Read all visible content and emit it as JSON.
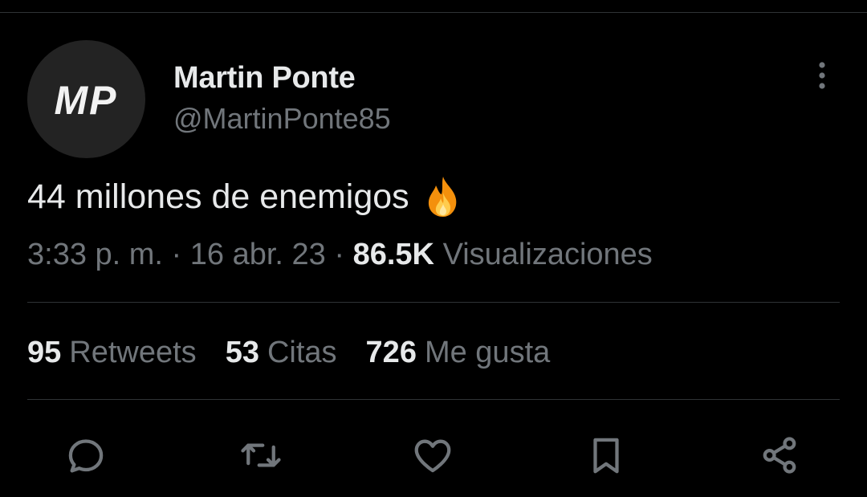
{
  "author": {
    "display_name": "Martin Ponte",
    "handle": "@MartinPonte85",
    "avatar_text": "MP"
  },
  "tweet": {
    "text": "44 millones de enemigos",
    "emoji": "fire-icon"
  },
  "meta": {
    "time": "3:33 p. m.",
    "separator": "·",
    "date": "16 abr. 23",
    "views_count": "86.5K",
    "views_label": "Visualizaciones"
  },
  "stats": {
    "retweets_count": "95",
    "retweets_label": "Retweets",
    "quotes_count": "53",
    "quotes_label": "Citas",
    "likes_count": "726",
    "likes_label": "Me gusta"
  },
  "actions": [
    "reply-icon",
    "retweet-icon",
    "like-icon",
    "bookmark-icon",
    "share-icon"
  ],
  "colors": {
    "background": "#000000",
    "primary_text": "#e7e9ea",
    "secondary_text": "#71767b",
    "divider": "#2f3336"
  }
}
